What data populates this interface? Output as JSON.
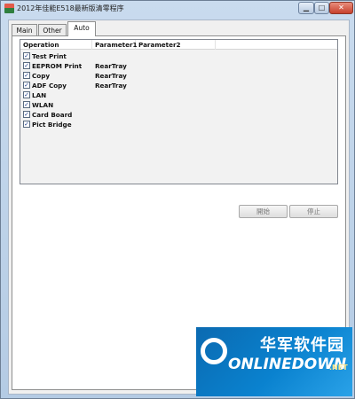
{
  "window": {
    "title": "2012年佳能E518最新版清零程序",
    "controls": {
      "minimize": "▁",
      "maximize": "□",
      "close": "✕"
    }
  },
  "tabs": [
    {
      "label": "Main",
      "selected": false
    },
    {
      "label": "Other",
      "selected": false
    },
    {
      "label": "Auto",
      "selected": true
    }
  ],
  "list": {
    "columns": [
      "Operation",
      "Parameter1",
      "Parameter2"
    ],
    "rows": [
      {
        "checked": true,
        "operation": "Test Print",
        "parameter1": "",
        "parameter2": ""
      },
      {
        "checked": true,
        "operation": "EEPROM Print",
        "parameter1": "RearTray",
        "parameter2": ""
      },
      {
        "checked": true,
        "operation": "Copy",
        "parameter1": "RearTray",
        "parameter2": ""
      },
      {
        "checked": true,
        "operation": "ADF Copy",
        "parameter1": "RearTray",
        "parameter2": ""
      },
      {
        "checked": true,
        "operation": "LAN",
        "parameter1": "",
        "parameter2": ""
      },
      {
        "checked": true,
        "operation": "WLAN",
        "parameter1": "",
        "parameter2": ""
      },
      {
        "checked": true,
        "operation": "Card Board",
        "parameter1": "",
        "parameter2": ""
      },
      {
        "checked": true,
        "operation": "Pict Bridge",
        "parameter1": "",
        "parameter2": ""
      }
    ],
    "check_mark": "✓"
  },
  "buttons": {
    "start": "開始",
    "stop": "停止"
  },
  "watermark": {
    "cn": "华军软件园",
    "en": "ONLINEDOWN",
    "net": ".NET"
  }
}
